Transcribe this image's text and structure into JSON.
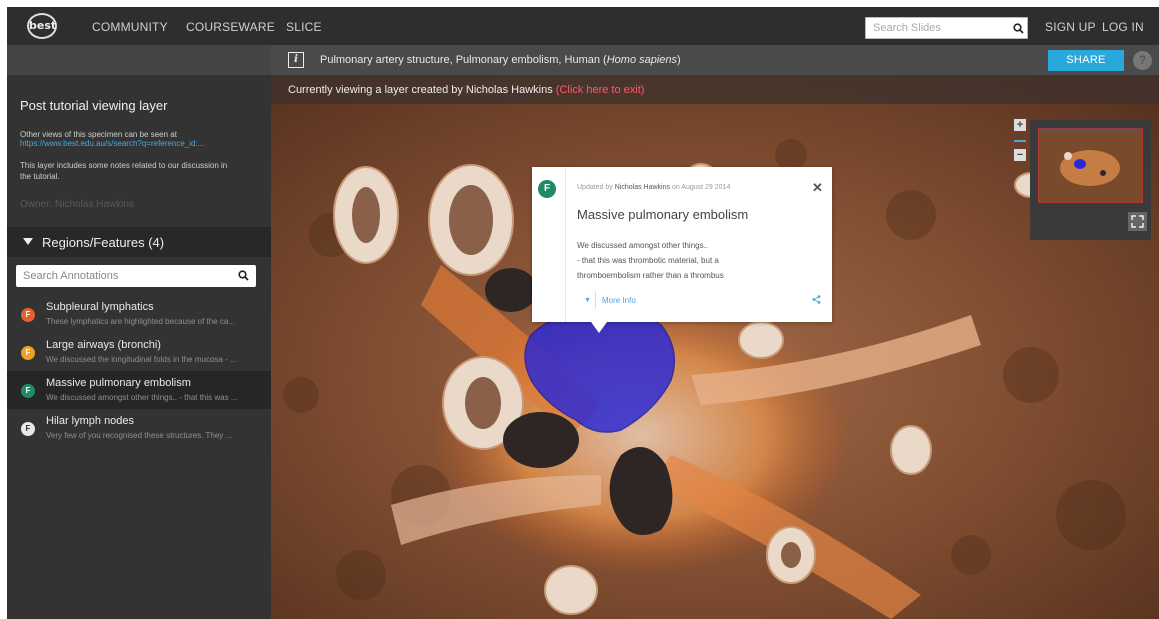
{
  "nav": {
    "logo_text": "best",
    "links": [
      "COMMUNITY",
      "COURSEWARE",
      "SLICE"
    ],
    "search_placeholder": "Search Slides",
    "sign_up": "SIGN UP",
    "log_in": "LOG IN"
  },
  "specimen": {
    "info_icon": "i",
    "title": "Pulmonary artery structure, Pulmonary embolism, Human (",
    "title_species": "Homo sapiens",
    "title_end": ")",
    "share_label": "SHARE",
    "help_label": "?"
  },
  "layer": {
    "viewing_text": "Currently viewing a layer created by Nicholas Hawkins ",
    "exit_text": "(Click here to exit)"
  },
  "sidebar": {
    "title": "Post tutorial viewing layer",
    "views_text": "Other views of this specimen can be seen at",
    "views_link": "https://www.best.edu.au/s/search?q=reference_id:...",
    "notes_line1": "This layer includes some notes related to our discussion in",
    "notes_line2": "the tutorial.",
    "owner": "Owner: Nicholas Hawkins",
    "regions_label": "Regions/Features (4)",
    "search_placeholder": "Search Annotations",
    "annotations": [
      {
        "badge": "F",
        "title": "Subpleural lymphatics",
        "desc": "These lymphatics are highlighted because of the ca...",
        "color": "#e0622a"
      },
      {
        "badge": "F",
        "title": "Large airways (bronchi)",
        "desc": "We discussed the longitudinal folds in the mucosa - ...",
        "color": "#f0a020"
      },
      {
        "badge": "F",
        "title": "Massive pulmonary embolism",
        "desc": "We discussed amongst other things.. - that this was ...",
        "color": "#1f8a68"
      },
      {
        "badge": "F",
        "title": "Hilar lymph nodes",
        "desc": "Very few of you recognised these structures. They ...",
        "color": "#e8e8e8"
      }
    ]
  },
  "popup": {
    "badge": "F",
    "updated_prefix": "Updated by ",
    "author": "Nicholas Hawkins",
    "updated_suffix": " on August 29 2014",
    "title": "Massive pulmonary embolism",
    "body_lines": [
      "We discussed  amongst other things..",
      " - that this was thrombotic material, but a",
      "thromboembolism rather than a thrombus"
    ],
    "more_info": "More Info"
  },
  "viewer": {
    "zoom_in": "+",
    "zoom_out": "−"
  },
  "colors": {
    "accent": "#2aa8dc",
    "exit_link": "#ff5a6a",
    "highlight_region": "#2828d8"
  }
}
